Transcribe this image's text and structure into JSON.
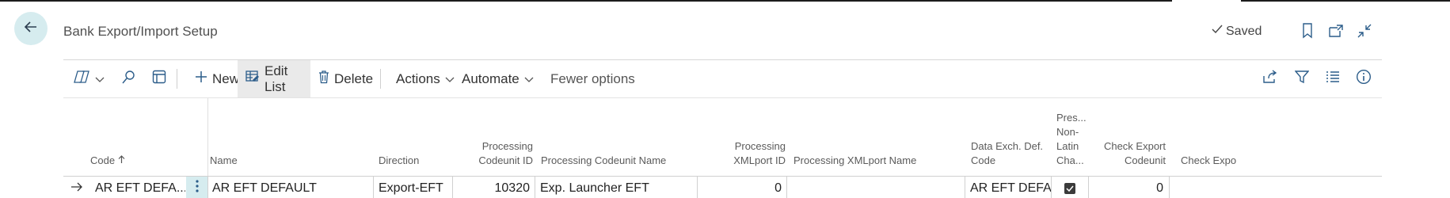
{
  "page": {
    "title": "Bank Export/Import Setup",
    "saved_label": "Saved"
  },
  "toolbar": {
    "new_label": "New",
    "edit_list_label": "Edit List",
    "delete_label": "Delete",
    "actions_label": "Actions",
    "automate_label": "Automate",
    "fewer_options_label": "Fewer options"
  },
  "grid": {
    "headers": {
      "code": "Code",
      "name": "Name",
      "direction": "Direction",
      "proc_codeunit_id_1": "Processing",
      "proc_codeunit_id_2": "Codeunit ID",
      "proc_codeunit_name": "Processing Codeunit Name",
      "proc_xmlport_id_1": "Processing",
      "proc_xmlport_id_2": "XMLport ID",
      "proc_xmlport_name": "Processing XMLport Name",
      "data_exch_1": "Data Exch. Def.",
      "data_exch_2": "Code",
      "pres_1": "Pres...",
      "pres_2": "Non-",
      "pres_3": "Latin",
      "pres_4": "Cha...",
      "check_export_1": "Check Export",
      "check_export_2": "Codeunit",
      "check_export_cut": "Check Expo"
    },
    "rows": [
      {
        "code": "AR EFT DEFA...",
        "name": "AR EFT DEFAULT",
        "direction": "Export-EFT",
        "processing_codeunit_id": "10320",
        "processing_codeunit_name": "Exp. Launcher EFT",
        "processing_xmlport_id": "0",
        "processing_xmlport_name": "",
        "data_exch_def_code": "AR EFT DEFA...",
        "preserve_non_latin": true,
        "check_export_codeunit": "0"
      }
    ]
  },
  "icons": {
    "back": "back-arrow-icon",
    "bookmark": "bookmark-icon",
    "open_new": "open-in-new-window-icon",
    "collapse": "collapse-icon",
    "share": "share-icon",
    "filter": "filter-icon",
    "list": "list-view-icon",
    "info": "info-icon"
  },
  "colors": {
    "accent_light": "#d6ecef",
    "active_button": "#eaeaea",
    "icon_blue": "#2c5d8a"
  }
}
